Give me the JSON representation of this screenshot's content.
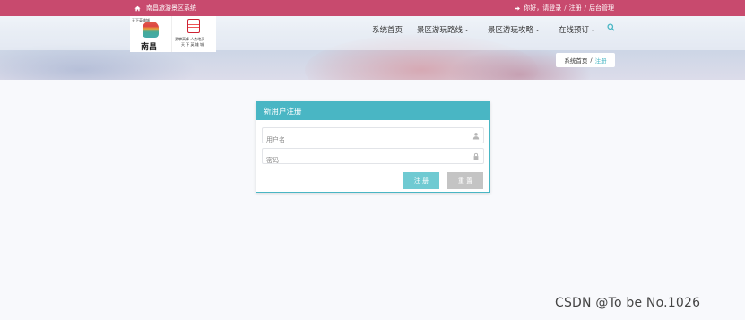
{
  "topbar": {
    "site_name": "南昌旅游景区系统",
    "guest_text": "你好，请登录",
    "register_link": "注册",
    "admin_link": "后台管理",
    "separator": "/"
  },
  "logo": {
    "left_small_text": "天下英雄城",
    "left_big_text": "南昌",
    "right_line1": "勇攀高峰  人杰地灵",
    "right_line2": "天 下 英 雄 城"
  },
  "nav": {
    "items": [
      {
        "label": "系统首页",
        "has_dropdown": false
      },
      {
        "label": "景区游玩路线",
        "has_dropdown": true
      },
      {
        "label": "景区游玩攻略",
        "has_dropdown": true
      },
      {
        "label": "在线预订",
        "has_dropdown": true
      }
    ]
  },
  "breadcrumb": {
    "home": "系统首页",
    "separator": "/",
    "current": "注册"
  },
  "form": {
    "title": "新用户注册",
    "username_placeholder": "用户名",
    "password_placeholder": "密码",
    "register_label": "注 册",
    "reset_label": "重 置"
  },
  "watermark": "CSDN @To be No.1026",
  "colors": {
    "topbar": "#c84a6e",
    "accent": "#49b6c4",
    "register_button": "#6fcad2",
    "reset_button": "#c4c4c4"
  }
}
